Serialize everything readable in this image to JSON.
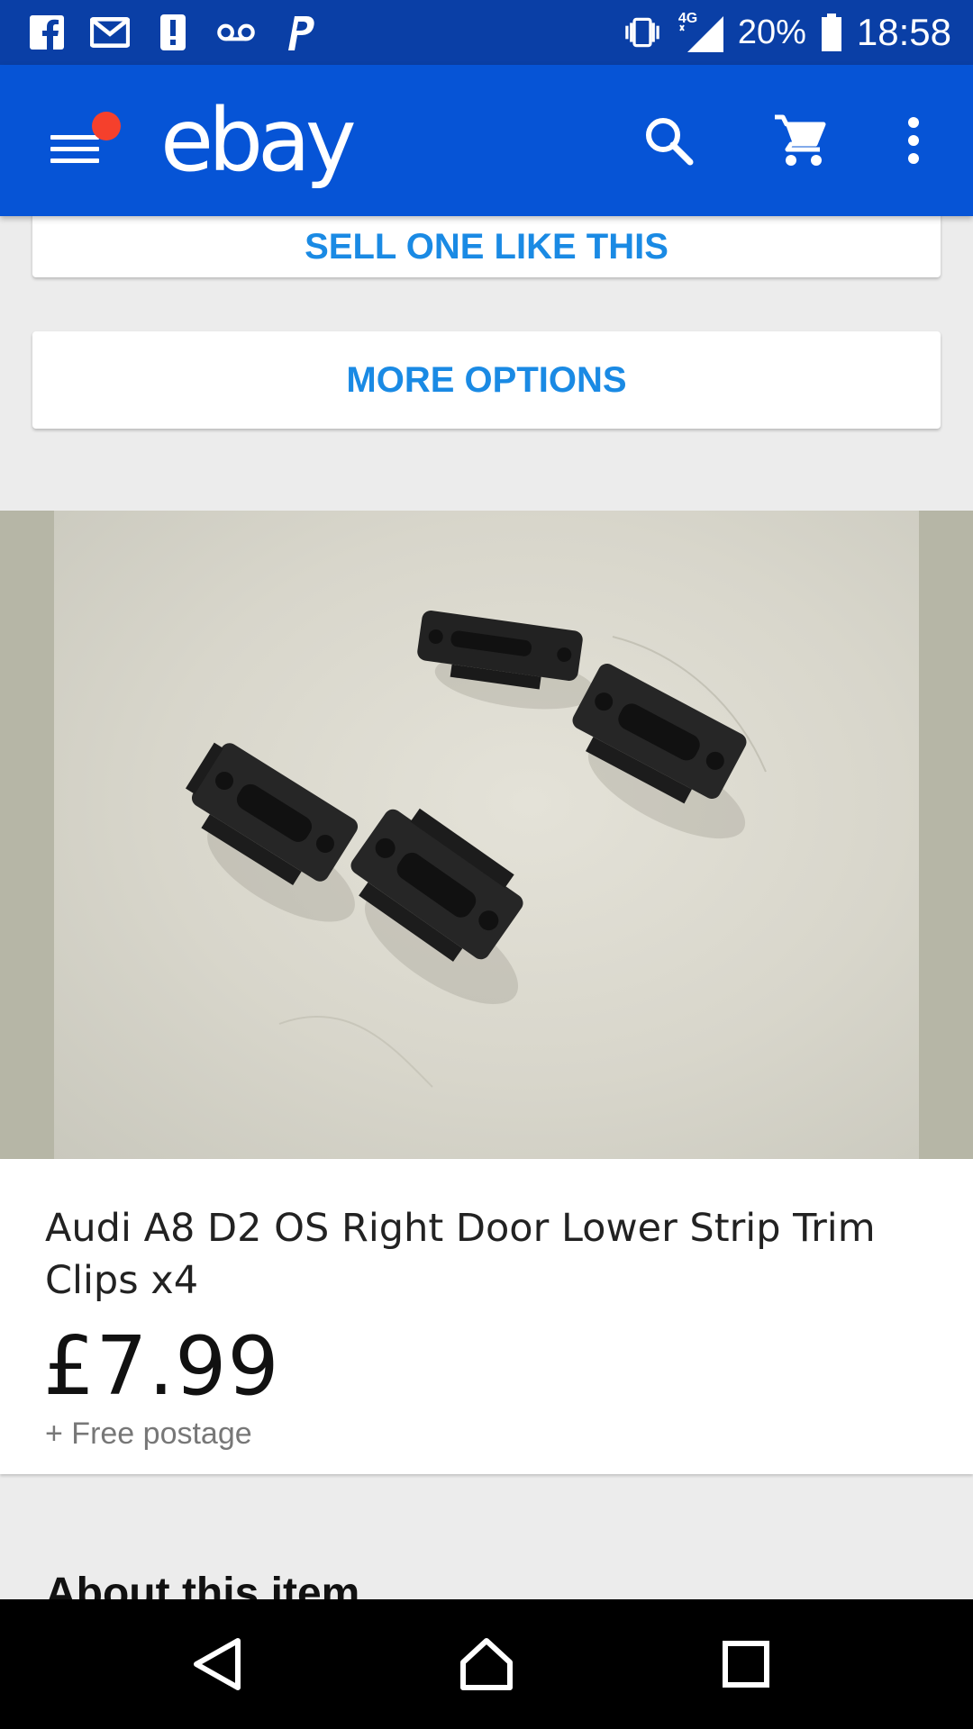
{
  "status_bar": {
    "left_icons": [
      "facebook-icon",
      "gmail-icon",
      "alert-icon",
      "voicemail-icon",
      "paypal-icon"
    ],
    "network": "4G",
    "battery": "20%",
    "time": "18:58"
  },
  "app_bar": {
    "logo": "ebay",
    "icons": [
      "menu-icon",
      "search-icon",
      "cart-icon",
      "more-vert-icon"
    ],
    "notification_color": "#f5402c",
    "background": "#0654d6"
  },
  "actions": {
    "sell_label": "SELL ONE LIKE THIS",
    "more_label": "MORE OPTIONS",
    "accent": "#1a8ae4"
  },
  "listing": {
    "image_alt": "four black plastic trim clips",
    "title": "Audi A8 D2 OS Right Door Lower Strip Trim Clips x4",
    "price": "£7.99",
    "postage": "+ Free postage"
  },
  "next_section": {
    "heading": "About this item"
  },
  "nav_bar": {
    "icons": [
      "back-icon",
      "home-icon",
      "recents-icon"
    ]
  }
}
